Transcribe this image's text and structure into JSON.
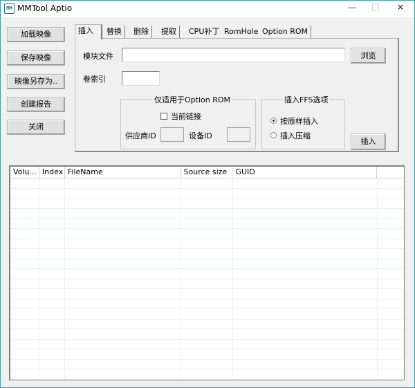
{
  "window": {
    "title": "MMTool Aptio",
    "icon_text": "MM",
    "controls": {
      "minimize": "—",
      "maximize": "☐",
      "close": "✕"
    }
  },
  "sidebar": {
    "buttons": [
      {
        "label": "加载映像"
      },
      {
        "label": "保存映像"
      },
      {
        "label": "映像另存为.."
      },
      {
        "label": "创建报告"
      },
      {
        "label": "关闭"
      }
    ]
  },
  "tabs": [
    {
      "label": "插入",
      "active": true
    },
    {
      "label": "替换"
    },
    {
      "label": "删除"
    },
    {
      "label": "提取"
    },
    {
      "label": "CPU补丁"
    },
    {
      "label": "RomHole"
    },
    {
      "label": "Option ROM"
    }
  ],
  "insert_panel": {
    "module_file_label": "模块文件",
    "module_file_value": "",
    "browse_label": "浏览",
    "volume_index_label": "卷索引",
    "volume_index_value": "",
    "option_rom_group": {
      "title": "仅适用于Option ROM",
      "link_checkbox_label": "当前链接",
      "link_checked": false,
      "vendor_id_label": "供应商ID",
      "vendor_id_value": "",
      "device_id_label": "设备ID",
      "device_id_value": ""
    },
    "ffs_group": {
      "title": "插入FFS选项",
      "options": [
        {
          "label": "按原样插入",
          "selected": true
        },
        {
          "label": "插入压缩",
          "selected": false
        }
      ]
    },
    "insert_button_label": "插入"
  },
  "table": {
    "columns": [
      "Volu...",
      "Index",
      "FileName",
      "Source size",
      "GUID",
      ""
    ],
    "rows": []
  }
}
